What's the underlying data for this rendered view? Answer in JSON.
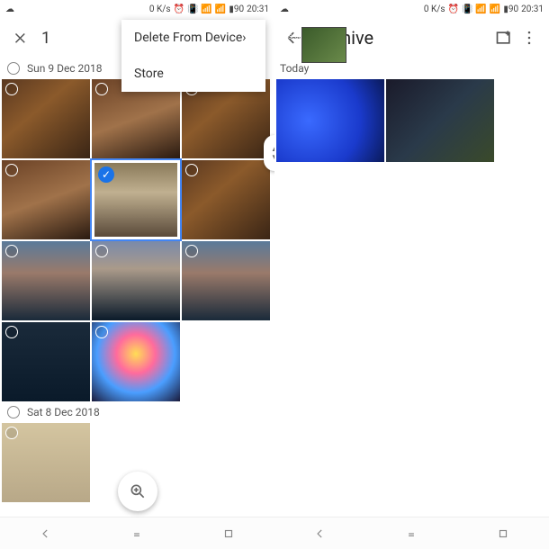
{
  "status": {
    "speed": "0 K/s",
    "battery": "90",
    "time": "20:31"
  },
  "left": {
    "count": "1",
    "menu": {
      "delete": "Delete From Device›",
      "store": "Store"
    },
    "dates": {
      "d1": "Sun 9 Dec 2018",
      "d2": "Sat 8 Dec 2018"
    }
  },
  "right": {
    "title": "Archive",
    "today": "Today"
  }
}
